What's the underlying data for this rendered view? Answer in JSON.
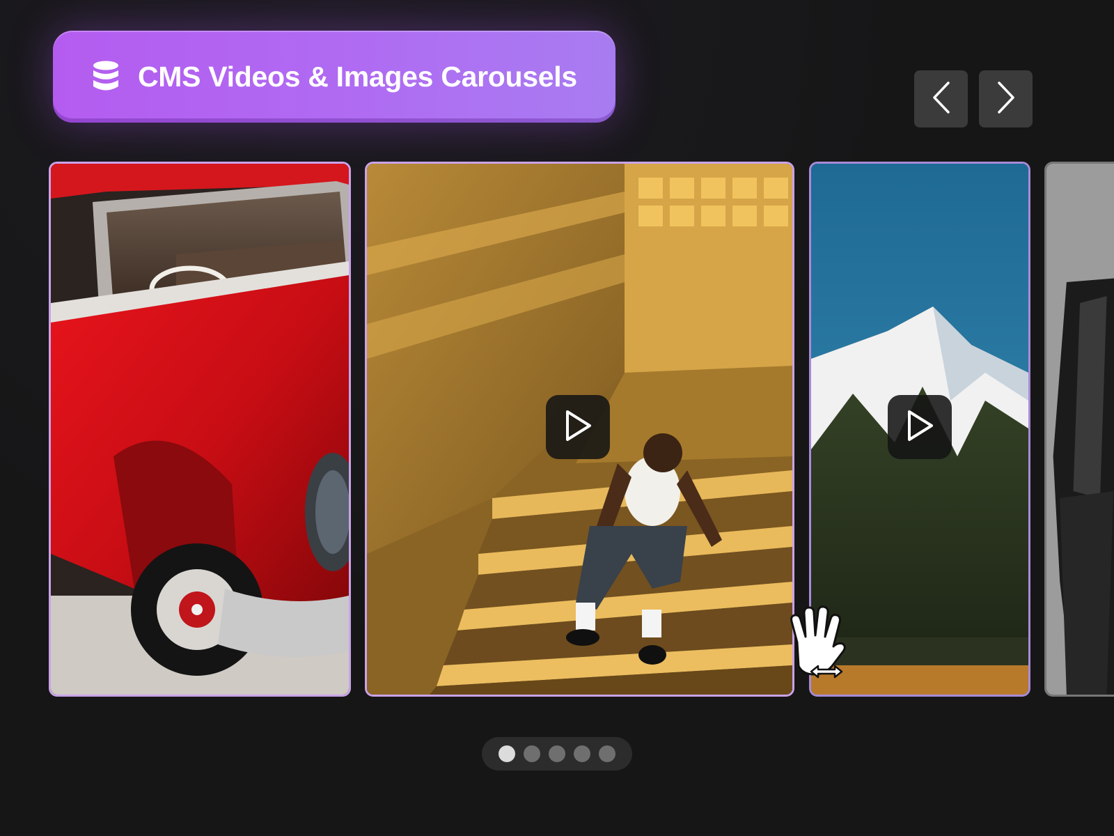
{
  "header": {
    "title": "CMS Videos & Images Carousels",
    "icon": "database-icon"
  },
  "navigation": {
    "prev_icon": "chevron-left-icon",
    "next_icon": "chevron-right-icon"
  },
  "carousel": {
    "slides": [
      {
        "kind": "image",
        "subject": "red vintage car"
      },
      {
        "kind": "video",
        "subject": "man sitting on sunlit stairs",
        "play_icon": "play-icon"
      },
      {
        "kind": "video",
        "subject": "snow-capped mountain",
        "play_icon": "play-icon"
      },
      {
        "kind": "image",
        "subject": "black leather outfit"
      }
    ],
    "pagination": {
      "total": 5,
      "active_index": 0
    }
  },
  "cursor": {
    "icon": "hand-drag-cursor-icon"
  },
  "colors": {
    "background": "#161616",
    "pill_gradient_start": "#b45cf0",
    "pill_gradient_end": "#a87cf1",
    "slide_border": "#c9a3e8",
    "nav_button": "#3b3b3b",
    "dot_active": "#dcdcdc",
    "dot_inactive": "#6f6f6f"
  }
}
